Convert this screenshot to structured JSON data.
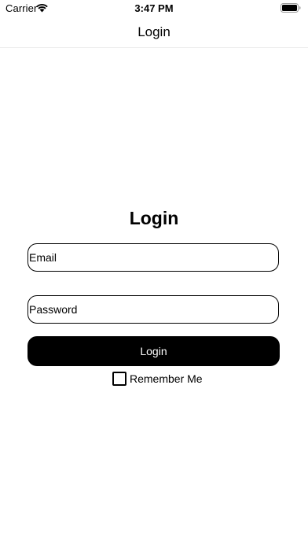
{
  "status_bar": {
    "carrier": "Carrier",
    "time": "3:47 PM",
    "wifi_icon": "wifi-icon",
    "battery_icon": "battery-icon"
  },
  "nav": {
    "title": "Login"
  },
  "form": {
    "heading": "Login",
    "email_placeholder": "Email",
    "email_value": "",
    "password_placeholder": "Password",
    "password_value": "",
    "login_button_label": "Login",
    "remember_label": "Remember Me",
    "remember_checked": false
  },
  "colors": {
    "background": "#ffffff",
    "primary": "#000000",
    "button_text": "#ffffff"
  }
}
